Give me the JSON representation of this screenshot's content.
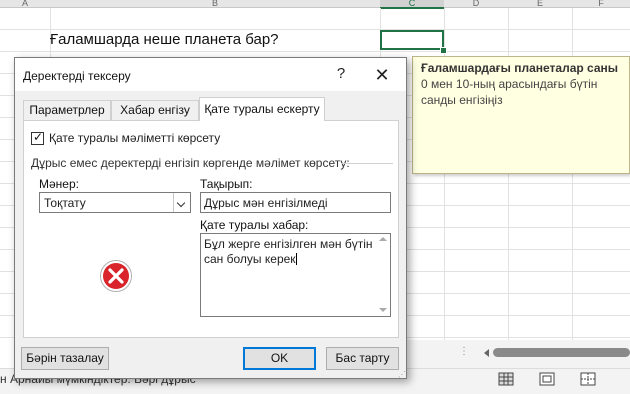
{
  "sheet": {
    "columns": [
      {
        "label": "A"
      },
      {
        "label": "B"
      },
      {
        "label": "C"
      },
      {
        "label": "D"
      },
      {
        "label": "E"
      },
      {
        "label": "F"
      }
    ],
    "question_cell": "Ғаламшарда неше планета бар?"
  },
  "tooltip": {
    "title": "Ғаламшардағы планеталар саны",
    "body": "0 мен 10-ның арасындағы бүтін санды енгізіңіз"
  },
  "status": {
    "text": "н  Арнайы мүмкіндіктер: Бәрі дұрыс"
  },
  "dialog": {
    "title": "Деректерді тексеру",
    "help": "?",
    "close": "✕",
    "tabs": [
      {
        "label": "Параметрлер"
      },
      {
        "label": "Хабар енгізу"
      },
      {
        "label": "Қате туралы ескерту"
      }
    ],
    "active_tab": "Қате туралы ескерту",
    "checkbox": {
      "label": "Қате туралы мәліметті көрсету",
      "checked": true
    },
    "group_label": "Дұрыс емес деректерді енгізіп көргенде мәлімет көрсету:",
    "style": {
      "label": "Мәнер:",
      "value": "Тоқтату"
    },
    "title_field": {
      "label": "Тақырып:",
      "value": "Дұрыс мән енгізілмеді"
    },
    "message_field": {
      "label": "Қате туралы хабар:",
      "value": "Бұл жерге енгізілген мән бүтін сан болуы керек"
    },
    "icon": "error-stop-icon",
    "buttons": {
      "clear": "Бәрін тазалау",
      "ok": "OK",
      "cancel": "Бас тарту"
    }
  },
  "colors": {
    "accent_green": "#217346",
    "tooltip_bg": "#ffffe1",
    "default_button_border": "#0078d7",
    "error_red": "#d9242b"
  }
}
